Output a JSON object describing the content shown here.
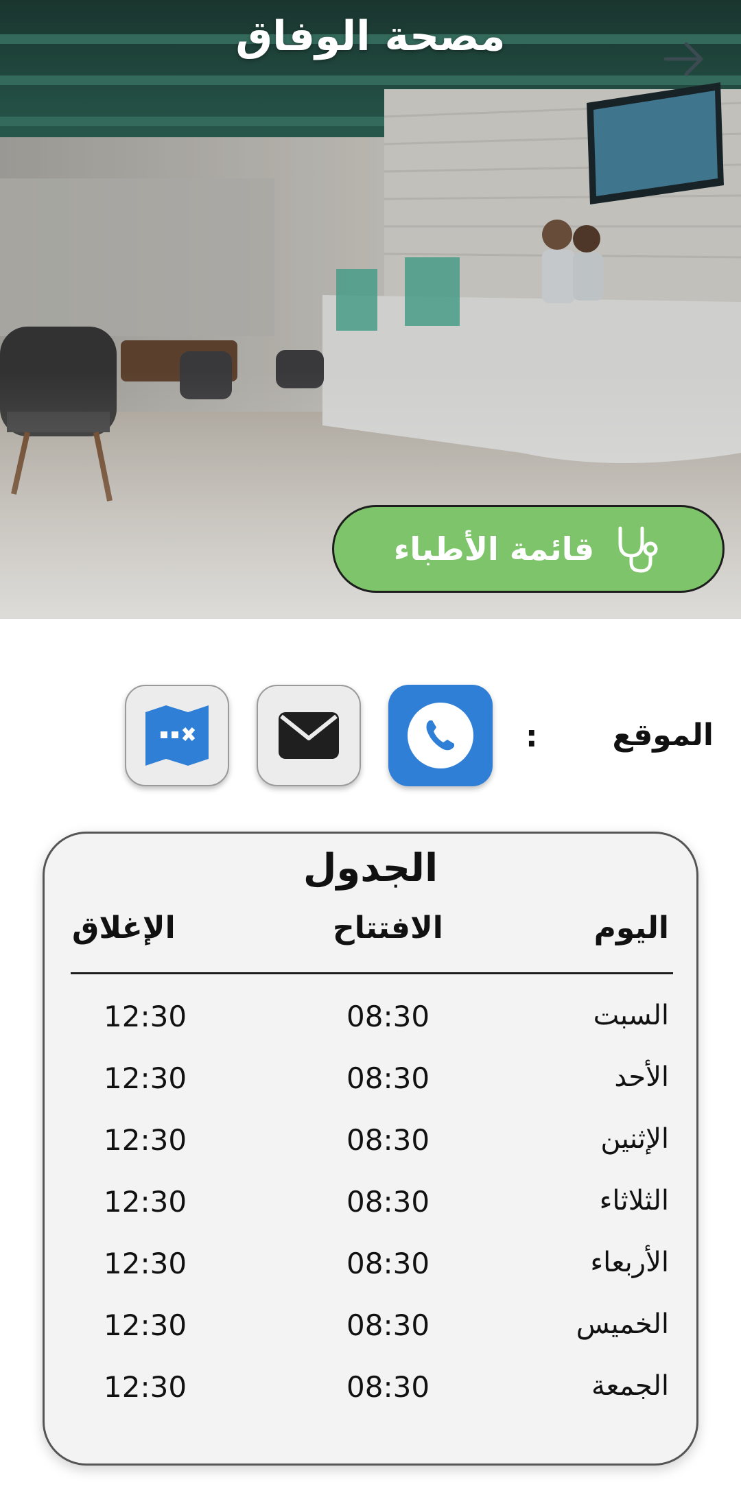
{
  "header": {
    "title": "مصحة الوفاق",
    "back_icon": "arrow-right-icon"
  },
  "hero": {
    "doctors_button_label": "قائمة الأطباء",
    "doctors_button_icon": "stethoscope-icon",
    "doctors_button_color": "#7ec46a"
  },
  "contact": {
    "location_label": "الموقع",
    "separator": ":",
    "phone_icon": "phone-icon",
    "mail_icon": "mail-icon",
    "map_icon": "map-icon",
    "phone_color": "#2f7fd6"
  },
  "schedule": {
    "title": "الجدول",
    "headers": {
      "day": "اليوم",
      "open": "الافتتاح",
      "close": "الإغلاق"
    },
    "rows": [
      {
        "day": "السبت",
        "open": "08:30",
        "close": "12:30"
      },
      {
        "day": "الأحد",
        "open": "08:30",
        "close": "12:30"
      },
      {
        "day": "الإثنين",
        "open": "08:30",
        "close": "12:30"
      },
      {
        "day": "الثلاثاء",
        "open": "08:30",
        "close": "12:30"
      },
      {
        "day": "الأربعاء",
        "open": "08:30",
        "close": "12:30"
      },
      {
        "day": "الخميس",
        "open": "08:30",
        "close": "12:30"
      },
      {
        "day": "الجمعة",
        "open": "08:30",
        "close": "12:30"
      }
    ]
  }
}
